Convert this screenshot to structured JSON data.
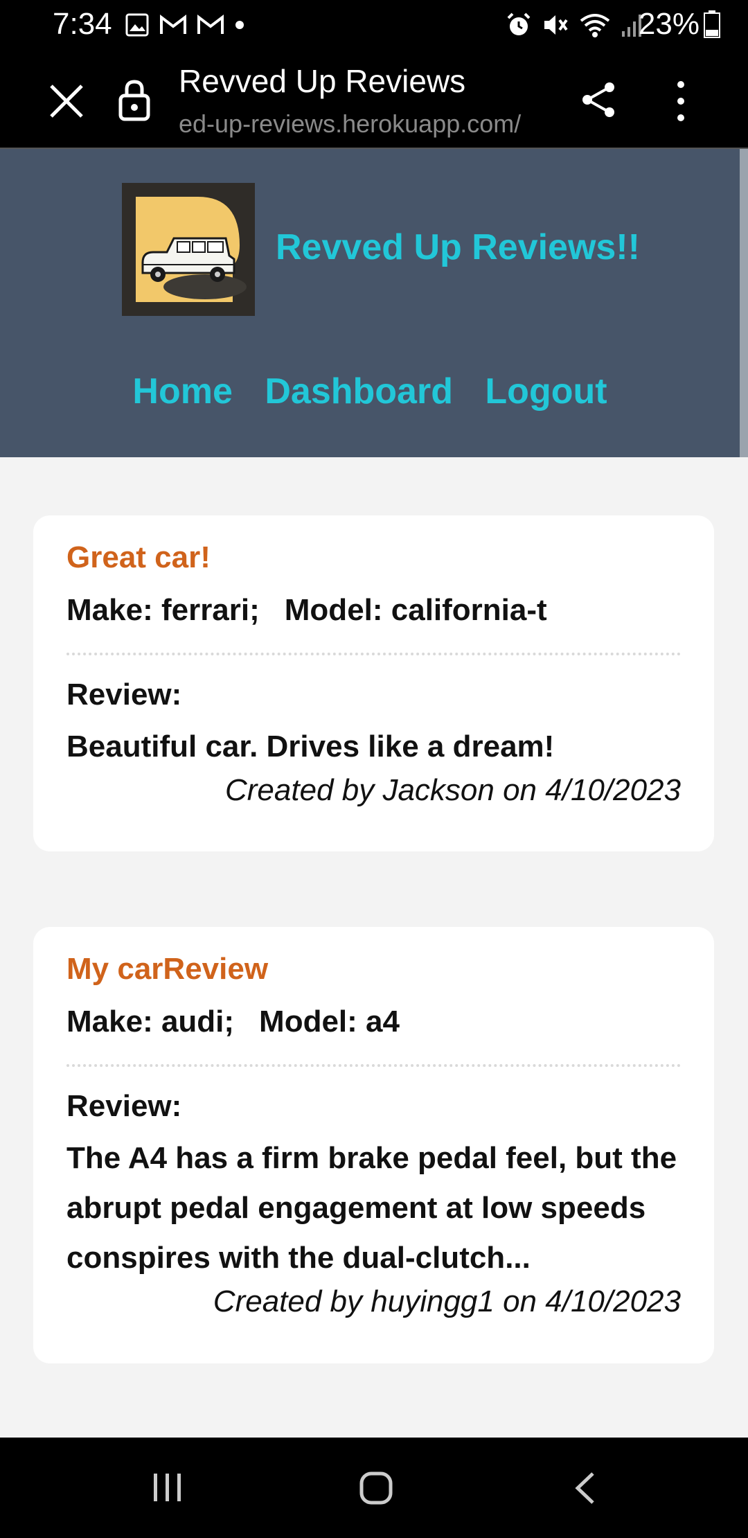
{
  "status_bar": {
    "time": "7:34",
    "battery": "23%",
    "icons_left": [
      "image-icon",
      "gmail-icon",
      "gmail-icon",
      "dot-icon"
    ],
    "icons_right": [
      "alarm-icon",
      "mute-icon",
      "wifi-icon",
      "signal-icon",
      "battery-icon"
    ]
  },
  "browser": {
    "title": "Revved Up Reviews",
    "url": "ed-up-reviews.herokuapp.com/"
  },
  "site": {
    "brand": "Revved Up Reviews!!",
    "nav": [
      "Home",
      "Dashboard",
      "Logout"
    ],
    "header_color": "#475569",
    "accent": "#22c7d8",
    "title_color": "#d0631b"
  },
  "reviews": [
    {
      "title": "Great car!",
      "make_label": "Make: ferrari;",
      "model_label": "Model: california-t",
      "review_label": "Review:",
      "review_text": "Beautiful car. Drives like a dream!",
      "created": "Created by Jackson on 4/10/2023"
    },
    {
      "title": "My carReview",
      "make_label": "Make: audi;",
      "model_label": "Model: a4",
      "review_label": "Review:",
      "review_text": "The A4 has a firm brake pedal feel, but the abrupt pedal engagement at low speeds conspires with the dual-clutch...",
      "created": "Created by huyingg1 on 4/10/2023"
    }
  ]
}
